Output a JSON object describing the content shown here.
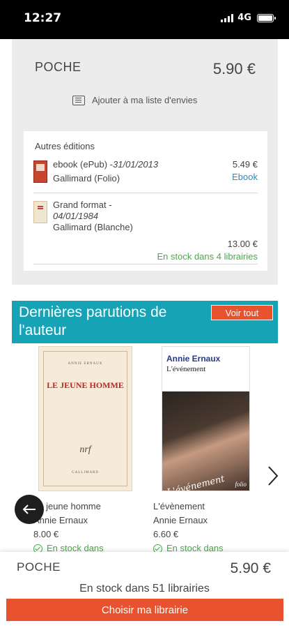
{
  "status_bar": {
    "time": "12:27",
    "network": "4G"
  },
  "product": {
    "format": "POCHE",
    "price": "5.90 €",
    "wishlist_label": "Ajouter à ma liste d'envies"
  },
  "editions": {
    "title": "Autres éditions",
    "items": [
      {
        "format": "ebook (ePub)",
        "date": "31/01/2013",
        "publisher": "Gallimard (Folio)",
        "price": "5.49 €",
        "link": "Ebook"
      },
      {
        "format": "Grand format -",
        "date": "04/01/1984",
        "publisher": "Gallimard (Blanche)",
        "price": "13.00 €",
        "stock": "En stock dans 4 librairies"
      }
    ]
  },
  "author_section": {
    "title": "Dernières parutions de l'auteur",
    "see_all": "Voir tout"
  },
  "books": [
    {
      "cover_author": "ANNIE ERNAUX",
      "cover_title": "LE JEUNE HOMME",
      "cover_logo": "nrf",
      "cover_publisher": "GALLIMARD",
      "title": "Le jeune homme",
      "author": "Annie Ernaux",
      "price": "8.00 €",
      "stock": "En stock dans"
    },
    {
      "cover_author": "Annie Ernaux",
      "cover_title": "L'événement",
      "cover_script": "L'événement",
      "cover_publisher": "folio",
      "title": "L'évènement",
      "author": "Annie Ernaux",
      "price": "6.60 €",
      "stock": "En stock dans"
    }
  ],
  "bottom_bar": {
    "format": "POCHE",
    "price": "5.90 €",
    "stock": "En stock dans 51 librairies",
    "cta": "Choisir ma librairie"
  },
  "colors": {
    "accent_teal": "#17a3b6",
    "accent_orange": "#e8522e",
    "stock_green": "#4aa84a",
    "link_blue": "#2a8cc4"
  },
  "icons": [
    "signal-icon",
    "battery-icon",
    "wishlist-icon",
    "check-icon",
    "chevron-right-icon",
    "back-arrow-icon"
  ]
}
